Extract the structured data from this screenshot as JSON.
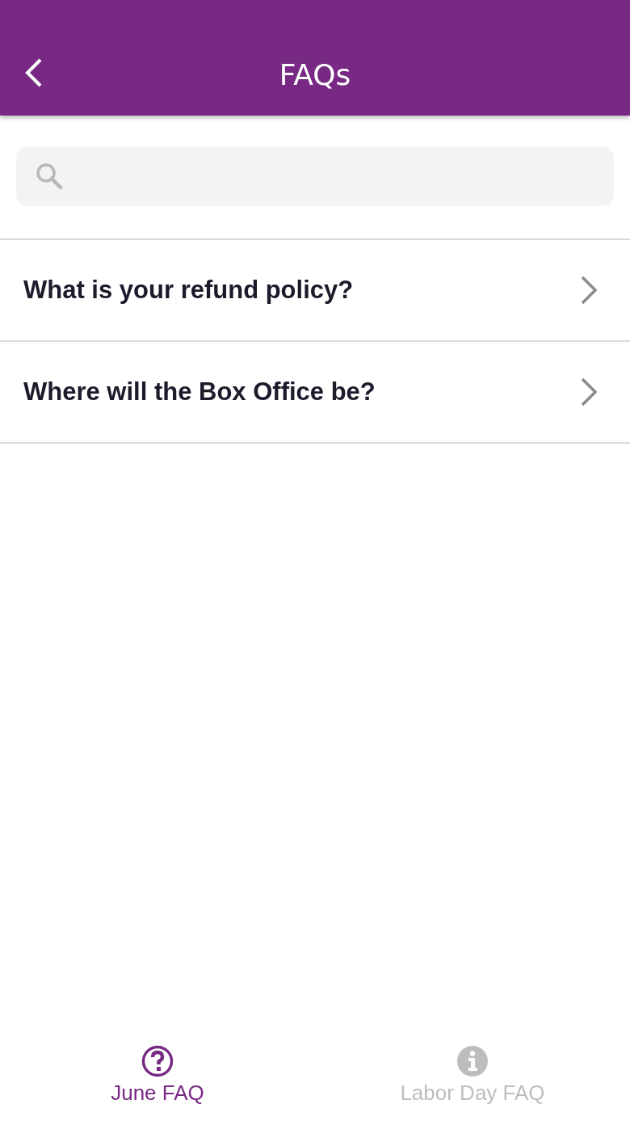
{
  "header": {
    "title": "FAQs"
  },
  "faqs": [
    {
      "question": "What is your refund policy?"
    },
    {
      "question": "Where will the Box Office be?"
    }
  ],
  "tabs": [
    {
      "label": "June FAQ",
      "kind": "question",
      "selected": true
    },
    {
      "label": "Labor Day FAQ",
      "kind": "info",
      "selected": false
    }
  ]
}
